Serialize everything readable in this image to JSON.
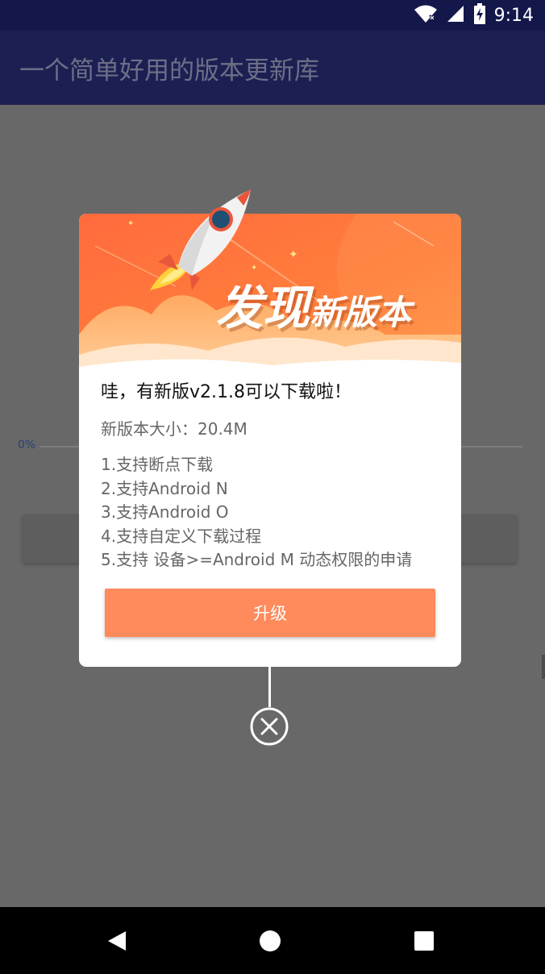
{
  "status_bar": {
    "time": "9:14",
    "icons": [
      "wifi-icon",
      "signal-icon",
      "battery-charging-icon"
    ]
  },
  "app_bar": {
    "title": "一个简单好用的版本更新库"
  },
  "background": {
    "progress_label": "0%",
    "progress": 0
  },
  "dialog": {
    "banner": {
      "title_big": "发现",
      "title_small": "新版本",
      "icon": "rocket-icon"
    },
    "headline": "哇，有新版v2.1.8可以下载啦！",
    "size_text": "新版本大小：20.4M",
    "notes": [
      "1.支持断点下载",
      "2.支持Android N",
      "3.支持Android O",
      "4.支持自定义下载过程",
      "5.支持 设备>=Android M 动态权限的申请"
    ],
    "upgrade_label": "升级",
    "close_icon": "close-icon"
  },
  "nav_bar": {
    "icons": [
      "back-icon",
      "home-icon",
      "recents-icon"
    ]
  },
  "colors": {
    "status_bar": "#13174a",
    "app_bar": "#1c1f52",
    "overlay": "#686868",
    "banner_orange": "#ff7a3d",
    "upgrade_button": "#ff8a5c"
  }
}
